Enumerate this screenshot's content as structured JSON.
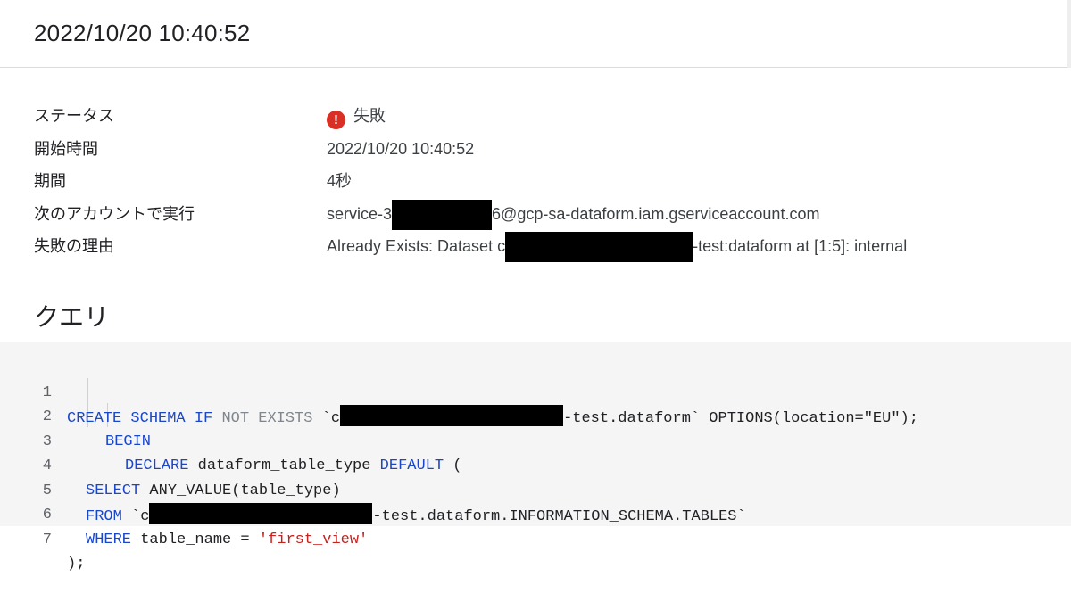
{
  "header": {
    "title": "2022/10/20 10:40:52"
  },
  "details": {
    "status_label": "ステータス",
    "status_value": "失敗",
    "status_icon": "error-icon",
    "start_label": "開始時間",
    "start_value": "2022/10/20 10:40:52",
    "duration_label": "期間",
    "duration_value": "4秒",
    "account_label": "次のアカウントで実行",
    "account_prefix": "service-3",
    "account_suffix": "6@gcp-sa-dataform.iam.gserviceaccount.com",
    "reason_label": "失敗の理由",
    "reason_prefix": "Already Exists: Dataset c",
    "reason_suffix": "-test:dataform at [1:5]: internal"
  },
  "query": {
    "title": "クエリ",
    "line_numbers": [
      "1",
      "2",
      "3",
      "4",
      "5",
      "6",
      "7"
    ],
    "l1_kw1": "CREATE SCHEMA IF",
    "l1_kw2": "NOT EXISTS",
    "l1_tick": "`c",
    "l1_rest": "-test.dataform` OPTIONS(location=\"EU\");",
    "l2_kw": "BEGIN",
    "l3_kw": "DECLARE",
    "l3_mid": "dataform_table_type",
    "l3_kw2": "DEFAULT",
    "l3_end": "(",
    "l4_kw": "SELECT",
    "l4_rest": "ANY_VALUE(table_type)",
    "l5_kw": "FROM",
    "l5_tick": "`c",
    "l5_rest": "-test.dataform.INFORMATION_SCHEMA.TABLES`",
    "l6_kw": "WHERE",
    "l6_mid": "table_name =",
    "l6_str": "'first_view'",
    "l7": ");"
  }
}
